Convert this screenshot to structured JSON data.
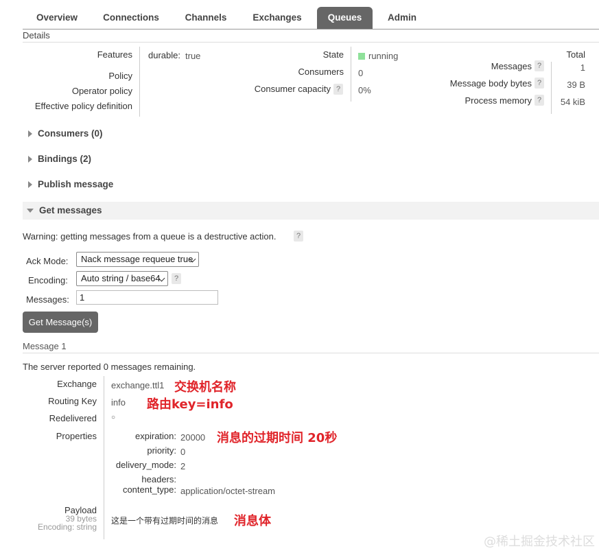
{
  "tabs": [
    "Overview",
    "Connections",
    "Channels",
    "Exchanges",
    "Queues",
    "Admin"
  ],
  "details": {
    "title": "Details",
    "features_label": "Features",
    "features_key": "durable:",
    "features_value": "true",
    "policy_label": "Policy",
    "operator_policy_label": "Operator policy",
    "effective_policy_label": "Effective policy definition",
    "state_label": "State",
    "state_value": "running",
    "consumers_label": "Consumers",
    "consumers_value": "0",
    "consumer_capacity_label": "Consumer capacity",
    "consumer_capacity_value": "0%",
    "total_header": "Total",
    "messages_label": "Messages",
    "messages_value": "1",
    "body_bytes_label": "Message body bytes",
    "body_bytes_value": "39 B",
    "process_memory_label": "Process memory",
    "process_memory_value": "54 kiB",
    "help": "?"
  },
  "sections": {
    "consumers": "Consumers (0)",
    "bindings": "Bindings (2)",
    "publish": "Publish message",
    "get": "Get messages"
  },
  "get_messages": {
    "warning": "Warning: getting messages from a queue is a destructive action.",
    "ack_mode_label": "Ack Mode:",
    "ack_mode_value": "Nack message requeue true",
    "encoding_label": "Encoding:",
    "encoding_value": "Auto string / base64",
    "messages_label": "Messages:",
    "messages_value": "1",
    "button": "Get Message(s)"
  },
  "message": {
    "title": "Message 1",
    "remaining": "The server reported 0 messages remaining.",
    "exchange_label": "Exchange",
    "exchange_value": "exchange.ttl1",
    "routing_key_label": "Routing Key",
    "routing_key_value": "info",
    "redelivered_label": "Redelivered",
    "redelivered_value": "○",
    "properties_label": "Properties",
    "expiration_label": "expiration:",
    "expiration_value": "20000",
    "priority_label": "priority:",
    "priority_value": "0",
    "delivery_mode_label": "delivery_mode:",
    "delivery_mode_value": "2",
    "headers_label": "headers:",
    "content_type_label": "content_type:",
    "content_type_value": "application/octet-stream",
    "payload_label": "Payload",
    "payload_bytes": "39 bytes",
    "payload_encoding": "Encoding: string",
    "payload_value": "这是一个带有过期时间的消息"
  },
  "annotations": {
    "exchange_note": "交换机名称",
    "routing_note": "路由key=info",
    "expiration_note": "消息的过期时间 20秒",
    "payload_note": "消息体"
  },
  "watermark": "@稀土掘金技术社区",
  "colors": {
    "tab_active": "#666666",
    "state_running": "#8fe19a",
    "annotation": "#e0242a"
  }
}
